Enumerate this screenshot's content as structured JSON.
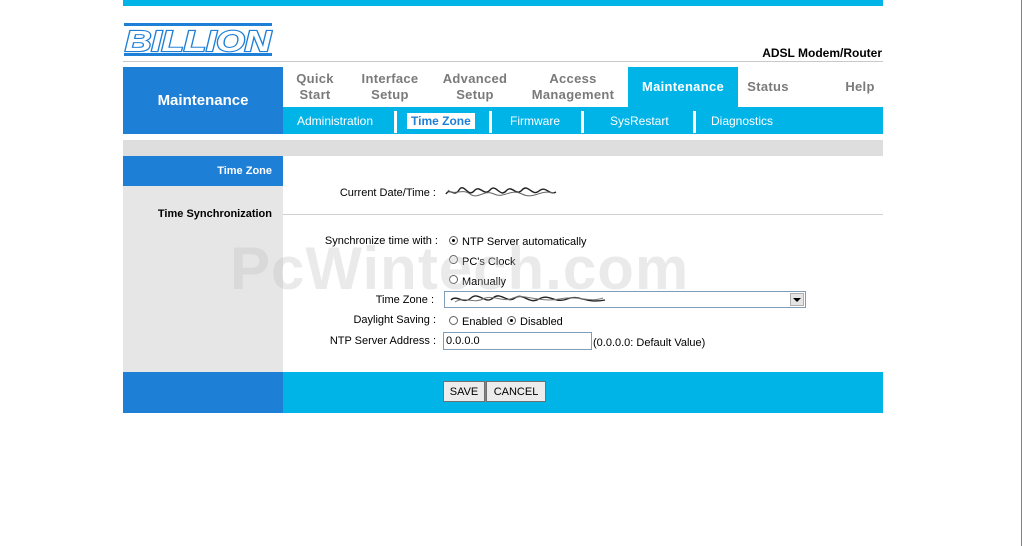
{
  "brand": {
    "logo_text": "BILLION",
    "product": "ADSL Modem/Router"
  },
  "nav": {
    "section_title": "Maintenance",
    "tabs": [
      {
        "line1": "Quick",
        "line2": "Start"
      },
      {
        "line1": "Interface",
        "line2": "Setup"
      },
      {
        "line1": "Advanced",
        "line2": "Setup"
      },
      {
        "line1": "Access",
        "line2": "Management"
      },
      {
        "line1": "Maintenance",
        "line2": ""
      },
      {
        "line1": "Status",
        "line2": ""
      },
      {
        "line1": "Help",
        "line2": ""
      }
    ],
    "active_tab": "Maintenance",
    "subtabs": [
      "Administration",
      "Time Zone",
      "Firmware",
      "SysRestart",
      "Diagnostics"
    ],
    "active_subtab": "Time Zone"
  },
  "sidebar": {
    "active_item": "Time Zone",
    "section": "Time Synchronization"
  },
  "form": {
    "current_datetime_label": "Current Date/Time :",
    "sync_label": "Synchronize time with :",
    "sync_options": [
      "NTP Server automatically",
      "PC's Clock",
      "Manually"
    ],
    "sync_selected": "NTP Server automatically",
    "timezone_label": "Time Zone :",
    "daylight_label": "Daylight Saving :",
    "daylight_options": [
      "Enabled",
      "Disabled"
    ],
    "daylight_selected": "Disabled",
    "ntp_label": "NTP Server Address :",
    "ntp_value": "0.0.0.0",
    "ntp_hint": "(0.0.0.0: Default Value)"
  },
  "buttons": {
    "save": "SAVE",
    "cancel": "CANCEL"
  },
  "watermark": "PcWintech.com",
  "colors": {
    "dark_blue": "#1e7fd6",
    "cyan": "#00b4e8",
    "gray": "#e6e6e6"
  }
}
